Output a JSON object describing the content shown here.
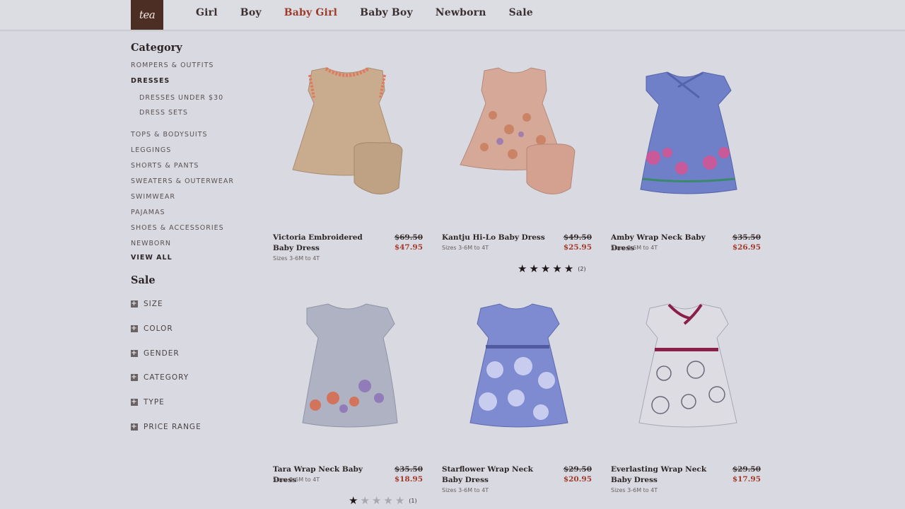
{
  "header": {
    "logo_text": "tea",
    "nav": [
      {
        "label": "Girl"
      },
      {
        "label": "Boy"
      },
      {
        "label": "Baby Girl",
        "active": true
      },
      {
        "label": "Baby Boy"
      },
      {
        "label": "Newborn"
      },
      {
        "label": "Sale"
      }
    ]
  },
  "sidebar": {
    "category_heading": "Category",
    "categories": [
      "ROMPERS & OUTFITS",
      "DRESSES",
      "DRESSES UNDER $30",
      "DRESS SETS",
      "TOPS & BODYSUITS",
      "LEGGINGS",
      "SHORTS & PANTS",
      "SWEATERS & OUTERWEAR",
      "SWIMWEAR",
      "PAJAMAS",
      "SHOES & ACCESSORIES",
      "NEWBORN",
      "VIEW ALL"
    ],
    "sale_heading": "Sale",
    "facets": [
      "SIZE",
      "COLOR",
      "GENDER",
      "CATEGORY",
      "TYPE",
      "PRICE RANGE"
    ]
  },
  "products": [
    {
      "name": "Victoria Embroidered Baby Dress",
      "was": "$69.50",
      "now": "$47.95",
      "sizes": "Sizes 3-6M to 4T",
      "image": "beige-embroidered-dress",
      "color": "#c9ab8e"
    },
    {
      "name": "Kantju Hi-Lo Baby Dress",
      "was": "$49.50",
      "now": "$25.95",
      "sizes": "Sizes 3-6M to 4T",
      "rating": 5,
      "reviews": "(2)",
      "image": "floral-pink-dress",
      "color": "#d6a898"
    },
    {
      "name": "Amby Wrap Neck Baby Dress",
      "was": "$35.50",
      "now": "$26.95",
      "sizes": "Sizes 3-6M to 4T",
      "image": "blue-floral-hem-dress",
      "color": "#6f7fc8"
    },
    {
      "name": "Tara Wrap Neck Baby Dress",
      "was": "$35.50",
      "now": "$18.95",
      "sizes": "Sizes 3-6M to 4T",
      "rating": 1,
      "reviews": "(1)",
      "image": "grey-floral-dress",
      "color": "#aeb2c2"
    },
    {
      "name": "Starflower Wrap Neck Baby Dress",
      "was": "$29.50",
      "now": "$20.95",
      "sizes": "Sizes 3-6M to 4T",
      "image": "blue-starflower-dress",
      "color": "#7f8bd0"
    },
    {
      "name": "Everlasting Wrap Neck Baby Dress",
      "was": "$29.50",
      "now": "$17.95",
      "sizes": "Sizes 3-6M to 4T",
      "image": "white-botanical-dress",
      "color": "#dcdce2"
    }
  ]
}
